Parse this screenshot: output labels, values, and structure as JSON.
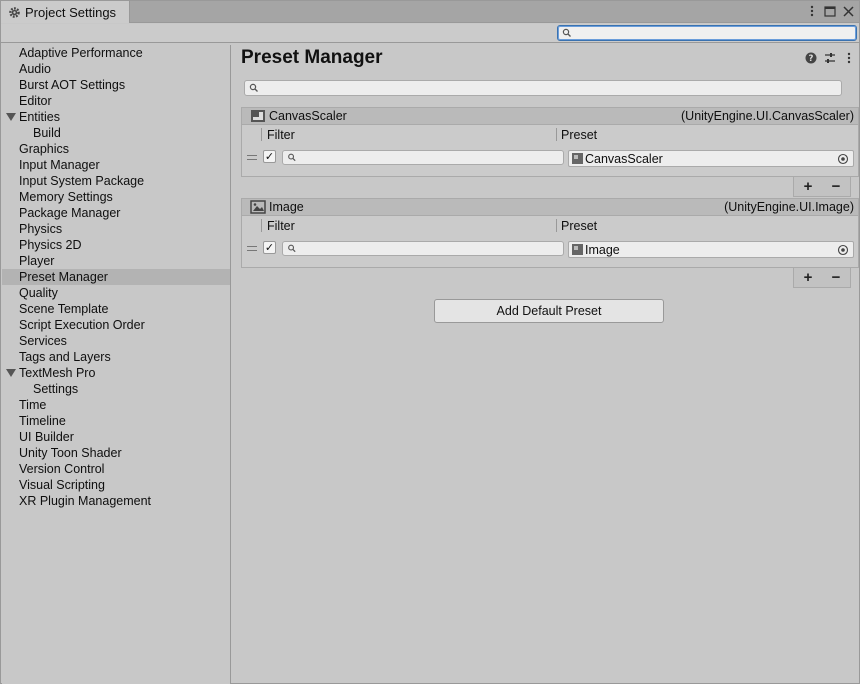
{
  "window": {
    "tab_title": "Project Settings",
    "icons": [
      "gear-icon",
      "kebab-menu-icon",
      "maximize-icon",
      "close-icon"
    ]
  },
  "toolbar": {
    "search_placeholder": ""
  },
  "sidebar": {
    "items": [
      {
        "label": "Adaptive Performance"
      },
      {
        "label": "Audio"
      },
      {
        "label": "Burst AOT Settings"
      },
      {
        "label": "Editor"
      },
      {
        "label": "Entities",
        "expanded": true
      },
      {
        "label": "Build",
        "child": true
      },
      {
        "label": "Graphics"
      },
      {
        "label": "Input Manager"
      },
      {
        "label": "Input System Package"
      },
      {
        "label": "Memory Settings"
      },
      {
        "label": "Package Manager"
      },
      {
        "label": "Physics"
      },
      {
        "label": "Physics 2D"
      },
      {
        "label": "Player"
      },
      {
        "label": "Preset Manager",
        "selected": true
      },
      {
        "label": "Quality"
      },
      {
        "label": "Scene Template"
      },
      {
        "label": "Script Execution Order"
      },
      {
        "label": "Services"
      },
      {
        "label": "Tags and Layers"
      },
      {
        "label": "TextMesh Pro",
        "expanded": true
      },
      {
        "label": "Settings",
        "child": true
      },
      {
        "label": "Time"
      },
      {
        "label": "Timeline"
      },
      {
        "label": "UI Builder"
      },
      {
        "label": "Unity Toon Shader"
      },
      {
        "label": "Version Control"
      },
      {
        "label": "Visual Scripting"
      },
      {
        "label": "XR Plugin Management"
      }
    ]
  },
  "main": {
    "title": "Preset Manager",
    "header_icons": [
      "help-icon",
      "sliders-icon",
      "kebab-menu-icon"
    ],
    "search_placeholder": "",
    "presets": [
      {
        "name": "CanvasScaler",
        "full_type": "(UnityEngine.UI.CanvasScaler)",
        "filter_header": "Filter",
        "preset_header": "Preset",
        "rows": [
          {
            "enabled": true,
            "filter": "",
            "preset": "CanvasScaler"
          }
        ]
      },
      {
        "name": "Image",
        "full_type": "(UnityEngine.UI.Image)",
        "filter_header": "Filter",
        "preset_header": "Preset",
        "rows": [
          {
            "enabled": true,
            "filter": "",
            "preset": "Image"
          }
        ]
      }
    ],
    "plus_label": "+",
    "minus_label": "−",
    "add_default_label": "Add Default Preset"
  }
}
